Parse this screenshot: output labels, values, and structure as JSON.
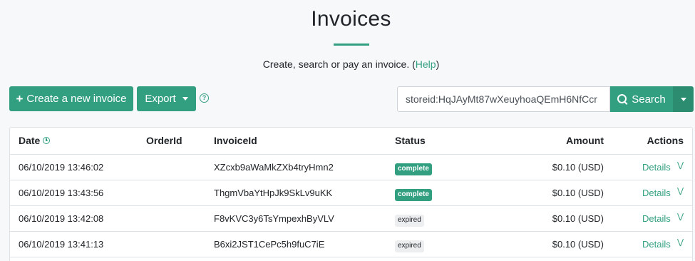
{
  "header": {
    "title": "Invoices",
    "subtitle_text": "Create, search or pay an invoice. (",
    "help_link": "Help",
    "subtitle_end": ")"
  },
  "toolbar": {
    "create_label": "Create a new invoice",
    "export_label": "Export",
    "search_value": "storeid:HqJAyMt87wXeuyhoaQEmH6NfCcr",
    "search_label": "Search"
  },
  "table": {
    "columns": {
      "date": "Date",
      "order_id": "OrderId",
      "invoice_id": "InvoiceId",
      "status": "Status",
      "amount": "Amount",
      "actions": "Actions"
    },
    "rows": [
      {
        "date": "06/10/2019 13:46:02",
        "invoice_id": "XZcxb9aWaMkZXb4tryHmn2",
        "status": "complete",
        "amount": "$0.10 (USD)",
        "action": "Details"
      },
      {
        "date": "06/10/2019 13:43:56",
        "invoice_id": "ThgmVbaYtHpJk9SkLv9uKK",
        "status": "complete",
        "amount": "$0.10 (USD)",
        "action": "Details"
      },
      {
        "date": "06/10/2019 13:42:08",
        "invoice_id": "F8vKVC3y6TsYmpexhByVLV",
        "status": "expired",
        "amount": "$0.10 (USD)",
        "action": "Details"
      },
      {
        "date": "06/10/2019 13:41:13",
        "invoice_id": "B6xi2JST1CePc5h9fuC7iE",
        "status": "expired",
        "amount": "$0.10 (USD)",
        "action": "Details"
      }
    ]
  },
  "colors": {
    "accent": "#329f80",
    "badge_expired": "#eceef0"
  },
  "icons": {
    "plus": "plus-icon",
    "caret": "caret-down-icon",
    "help": "question-circle-icon",
    "search": "search-icon",
    "clock": "clock-icon",
    "expand": "chevron-double-down-icon"
  }
}
